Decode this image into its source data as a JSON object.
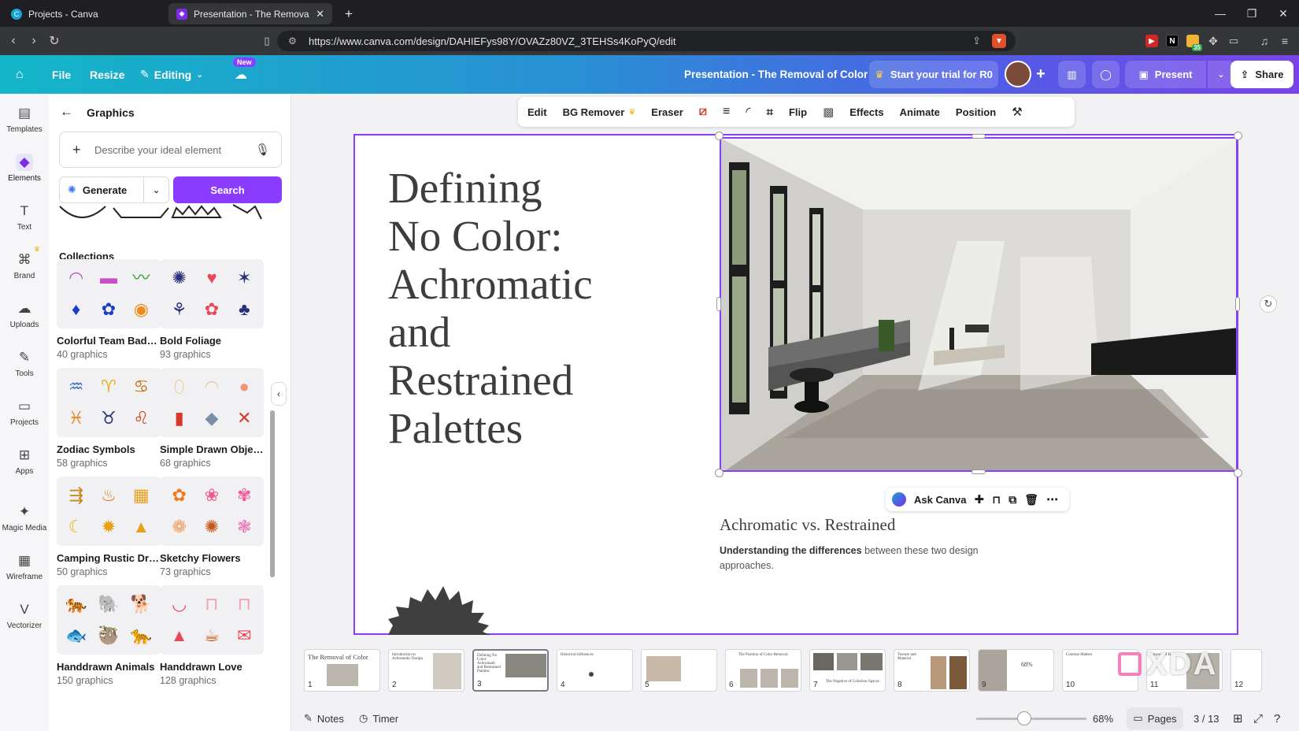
{
  "browser": {
    "tabs": [
      {
        "title": "Projects - Canva",
        "active": false
      },
      {
        "title": "Presentation - The Removal of C",
        "active": true
      }
    ],
    "url": "https://www.canva.com/design/DAHIEFys98Y/OVAZz80VZ_3TEHSs4KoPyQ/edit",
    "extension_badge": "35"
  },
  "header": {
    "file": "File",
    "resize": "Resize",
    "editing": "Editing",
    "new_badge": "New",
    "doc_title": "Presentation - The Removal of Color",
    "trial": "Start your trial for R0",
    "present": "Present",
    "share": "Share"
  },
  "rail": [
    {
      "label": "Templates",
      "icon": "template-icon"
    },
    {
      "label": "Elements",
      "icon": "elements-icon",
      "active": true
    },
    {
      "label": "Text",
      "icon": "text-icon"
    },
    {
      "label": "Brand",
      "icon": "brand-icon"
    },
    {
      "label": "Uploads",
      "icon": "upload-icon"
    },
    {
      "label": "Tools",
      "icon": "tools-icon"
    },
    {
      "label": "Projects",
      "icon": "folder-icon"
    },
    {
      "label": "Apps",
      "icon": "apps-icon"
    },
    {
      "label": "Magic Media",
      "icon": "magic-media-icon"
    },
    {
      "label": "Wireframe",
      "icon": "wireframe-icon"
    },
    {
      "label": "Vectorizer",
      "icon": "vectorizer-icon"
    }
  ],
  "panel": {
    "title": "Graphics",
    "search_placeholder": "Describe your ideal element",
    "generate": "Generate",
    "search": "Search",
    "collections_title": "Collections",
    "collections": [
      {
        "name": "Colorful Team Badges",
        "count": "40 graphics",
        "glyphs": [
          "◠",
          "▬",
          "〰",
          "♦",
          "✿",
          "◉"
        ]
      },
      {
        "name": "Bold Foliage",
        "count": "93 graphics",
        "glyphs": [
          "✺",
          "♥",
          "✶",
          "⚘",
          "✿",
          "♣"
        ]
      },
      {
        "name": "Zodiac Symbols",
        "count": "58 graphics",
        "glyphs": [
          "♒",
          "♈",
          "♋",
          "♓",
          "♉",
          "♌"
        ]
      },
      {
        "name": "Simple Drawn Objects",
        "count": "68 graphics",
        "glyphs": [
          "⬯",
          "◠",
          "●",
          "▮",
          "◆",
          "✕"
        ]
      },
      {
        "name": "Camping Rustic Dra...",
        "count": "50 graphics",
        "glyphs": [
          "⇶",
          "♨",
          "▦",
          "☾",
          "✹",
          "▲"
        ]
      },
      {
        "name": "Sketchy Flowers",
        "count": "73 graphics",
        "glyphs": [
          "✿",
          "❀",
          "✾",
          "❁",
          "✺",
          "❃"
        ]
      },
      {
        "name": "Handdrawn Animals",
        "count": "150 graphics",
        "glyphs": [
          "🐅",
          "🐘",
          "🐕",
          "🐟",
          "🦥",
          "🐆"
        ]
      },
      {
        "name": "Handdrawn Love",
        "count": "128 graphics",
        "glyphs": [
          "◡",
          "⊓",
          "⊓",
          "▲",
          "☕",
          "✉"
        ]
      }
    ]
  },
  "toolbar": {
    "items": [
      "Edit",
      "BG Remover",
      "Eraser",
      "Flip",
      "Effects",
      "Animate",
      "Position"
    ]
  },
  "slide": {
    "title": "Defining\nNo Color:\nAchromatic\nand\nRestrained\nPalettes",
    "subheading": "Achromatic vs. Restrained",
    "body_bold": "Understanding the differences",
    "body_rest": " between these two design approaches.",
    "ask_canva": "Ask Canva"
  },
  "pages": [
    {
      "n": "1",
      "label": "The Removal of Color"
    },
    {
      "n": "2",
      "label": "Introduction to Achromatic Design"
    },
    {
      "n": "3",
      "label": "Defining No Color: Achromatic and Restrained Palettes",
      "active": true
    },
    {
      "n": "4",
      "label": "Historical Influences"
    },
    {
      "n": "5",
      "label": ""
    },
    {
      "n": "6",
      "label": "The Position of Color Removal"
    },
    {
      "n": "7",
      "label": "The Negative of Colorless Spaces"
    },
    {
      "n": "8",
      "label": "Texture and Material"
    },
    {
      "n": "9",
      "label": "68%"
    },
    {
      "n": "10",
      "label": "Contrast Matters"
    },
    {
      "n": "11",
      "label": "Purpose of Balance"
    },
    {
      "n": "12",
      "label": ""
    }
  ],
  "footer": {
    "notes": "Notes",
    "timer": "Timer",
    "zoom": "68%",
    "zoom_fraction": 0.68,
    "pages": "Pages",
    "page_count": "3 / 13"
  },
  "watermark": "XDA",
  "colors": {
    "accent": "#8b3dff",
    "header_start": "#13b6c8",
    "header_end": "#7a43e8"
  }
}
